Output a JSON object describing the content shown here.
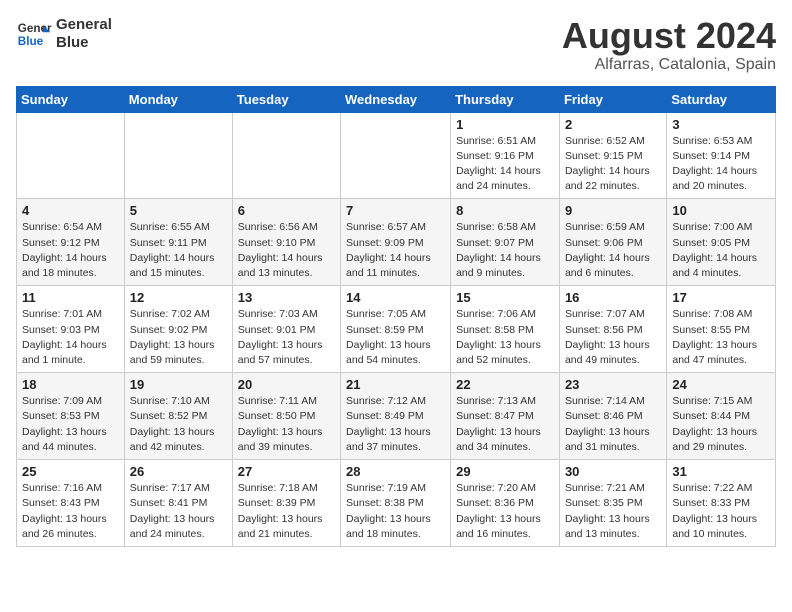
{
  "header": {
    "logo_line1": "General",
    "logo_line2": "Blue",
    "month_year": "August 2024",
    "location": "Alfarras, Catalonia, Spain"
  },
  "days_of_week": [
    "Sunday",
    "Monday",
    "Tuesday",
    "Wednesday",
    "Thursday",
    "Friday",
    "Saturday"
  ],
  "weeks": [
    [
      {
        "day": "",
        "info": ""
      },
      {
        "day": "",
        "info": ""
      },
      {
        "day": "",
        "info": ""
      },
      {
        "day": "",
        "info": ""
      },
      {
        "day": "1",
        "info": "Sunrise: 6:51 AM\nSunset: 9:16 PM\nDaylight: 14 hours\nand 24 minutes."
      },
      {
        "day": "2",
        "info": "Sunrise: 6:52 AM\nSunset: 9:15 PM\nDaylight: 14 hours\nand 22 minutes."
      },
      {
        "day": "3",
        "info": "Sunrise: 6:53 AM\nSunset: 9:14 PM\nDaylight: 14 hours\nand 20 minutes."
      }
    ],
    [
      {
        "day": "4",
        "info": "Sunrise: 6:54 AM\nSunset: 9:12 PM\nDaylight: 14 hours\nand 18 minutes."
      },
      {
        "day": "5",
        "info": "Sunrise: 6:55 AM\nSunset: 9:11 PM\nDaylight: 14 hours\nand 15 minutes."
      },
      {
        "day": "6",
        "info": "Sunrise: 6:56 AM\nSunset: 9:10 PM\nDaylight: 14 hours\nand 13 minutes."
      },
      {
        "day": "7",
        "info": "Sunrise: 6:57 AM\nSunset: 9:09 PM\nDaylight: 14 hours\nand 11 minutes."
      },
      {
        "day": "8",
        "info": "Sunrise: 6:58 AM\nSunset: 9:07 PM\nDaylight: 14 hours\nand 9 minutes."
      },
      {
        "day": "9",
        "info": "Sunrise: 6:59 AM\nSunset: 9:06 PM\nDaylight: 14 hours\nand 6 minutes."
      },
      {
        "day": "10",
        "info": "Sunrise: 7:00 AM\nSunset: 9:05 PM\nDaylight: 14 hours\nand 4 minutes."
      }
    ],
    [
      {
        "day": "11",
        "info": "Sunrise: 7:01 AM\nSunset: 9:03 PM\nDaylight: 14 hours\nand 1 minute."
      },
      {
        "day": "12",
        "info": "Sunrise: 7:02 AM\nSunset: 9:02 PM\nDaylight: 13 hours\nand 59 minutes."
      },
      {
        "day": "13",
        "info": "Sunrise: 7:03 AM\nSunset: 9:01 PM\nDaylight: 13 hours\nand 57 minutes."
      },
      {
        "day": "14",
        "info": "Sunrise: 7:05 AM\nSunset: 8:59 PM\nDaylight: 13 hours\nand 54 minutes."
      },
      {
        "day": "15",
        "info": "Sunrise: 7:06 AM\nSunset: 8:58 PM\nDaylight: 13 hours\nand 52 minutes."
      },
      {
        "day": "16",
        "info": "Sunrise: 7:07 AM\nSunset: 8:56 PM\nDaylight: 13 hours\nand 49 minutes."
      },
      {
        "day": "17",
        "info": "Sunrise: 7:08 AM\nSunset: 8:55 PM\nDaylight: 13 hours\nand 47 minutes."
      }
    ],
    [
      {
        "day": "18",
        "info": "Sunrise: 7:09 AM\nSunset: 8:53 PM\nDaylight: 13 hours\nand 44 minutes."
      },
      {
        "day": "19",
        "info": "Sunrise: 7:10 AM\nSunset: 8:52 PM\nDaylight: 13 hours\nand 42 minutes."
      },
      {
        "day": "20",
        "info": "Sunrise: 7:11 AM\nSunset: 8:50 PM\nDaylight: 13 hours\nand 39 minutes."
      },
      {
        "day": "21",
        "info": "Sunrise: 7:12 AM\nSunset: 8:49 PM\nDaylight: 13 hours\nand 37 minutes."
      },
      {
        "day": "22",
        "info": "Sunrise: 7:13 AM\nSunset: 8:47 PM\nDaylight: 13 hours\nand 34 minutes."
      },
      {
        "day": "23",
        "info": "Sunrise: 7:14 AM\nSunset: 8:46 PM\nDaylight: 13 hours\nand 31 minutes."
      },
      {
        "day": "24",
        "info": "Sunrise: 7:15 AM\nSunset: 8:44 PM\nDaylight: 13 hours\nand 29 minutes."
      }
    ],
    [
      {
        "day": "25",
        "info": "Sunrise: 7:16 AM\nSunset: 8:43 PM\nDaylight: 13 hours\nand 26 minutes."
      },
      {
        "day": "26",
        "info": "Sunrise: 7:17 AM\nSunset: 8:41 PM\nDaylight: 13 hours\nand 24 minutes."
      },
      {
        "day": "27",
        "info": "Sunrise: 7:18 AM\nSunset: 8:39 PM\nDaylight: 13 hours\nand 21 minutes."
      },
      {
        "day": "28",
        "info": "Sunrise: 7:19 AM\nSunset: 8:38 PM\nDaylight: 13 hours\nand 18 minutes."
      },
      {
        "day": "29",
        "info": "Sunrise: 7:20 AM\nSunset: 8:36 PM\nDaylight: 13 hours\nand 16 minutes."
      },
      {
        "day": "30",
        "info": "Sunrise: 7:21 AM\nSunset: 8:35 PM\nDaylight: 13 hours\nand 13 minutes."
      },
      {
        "day": "31",
        "info": "Sunrise: 7:22 AM\nSunset: 8:33 PM\nDaylight: 13 hours\nand 10 minutes."
      }
    ]
  ]
}
